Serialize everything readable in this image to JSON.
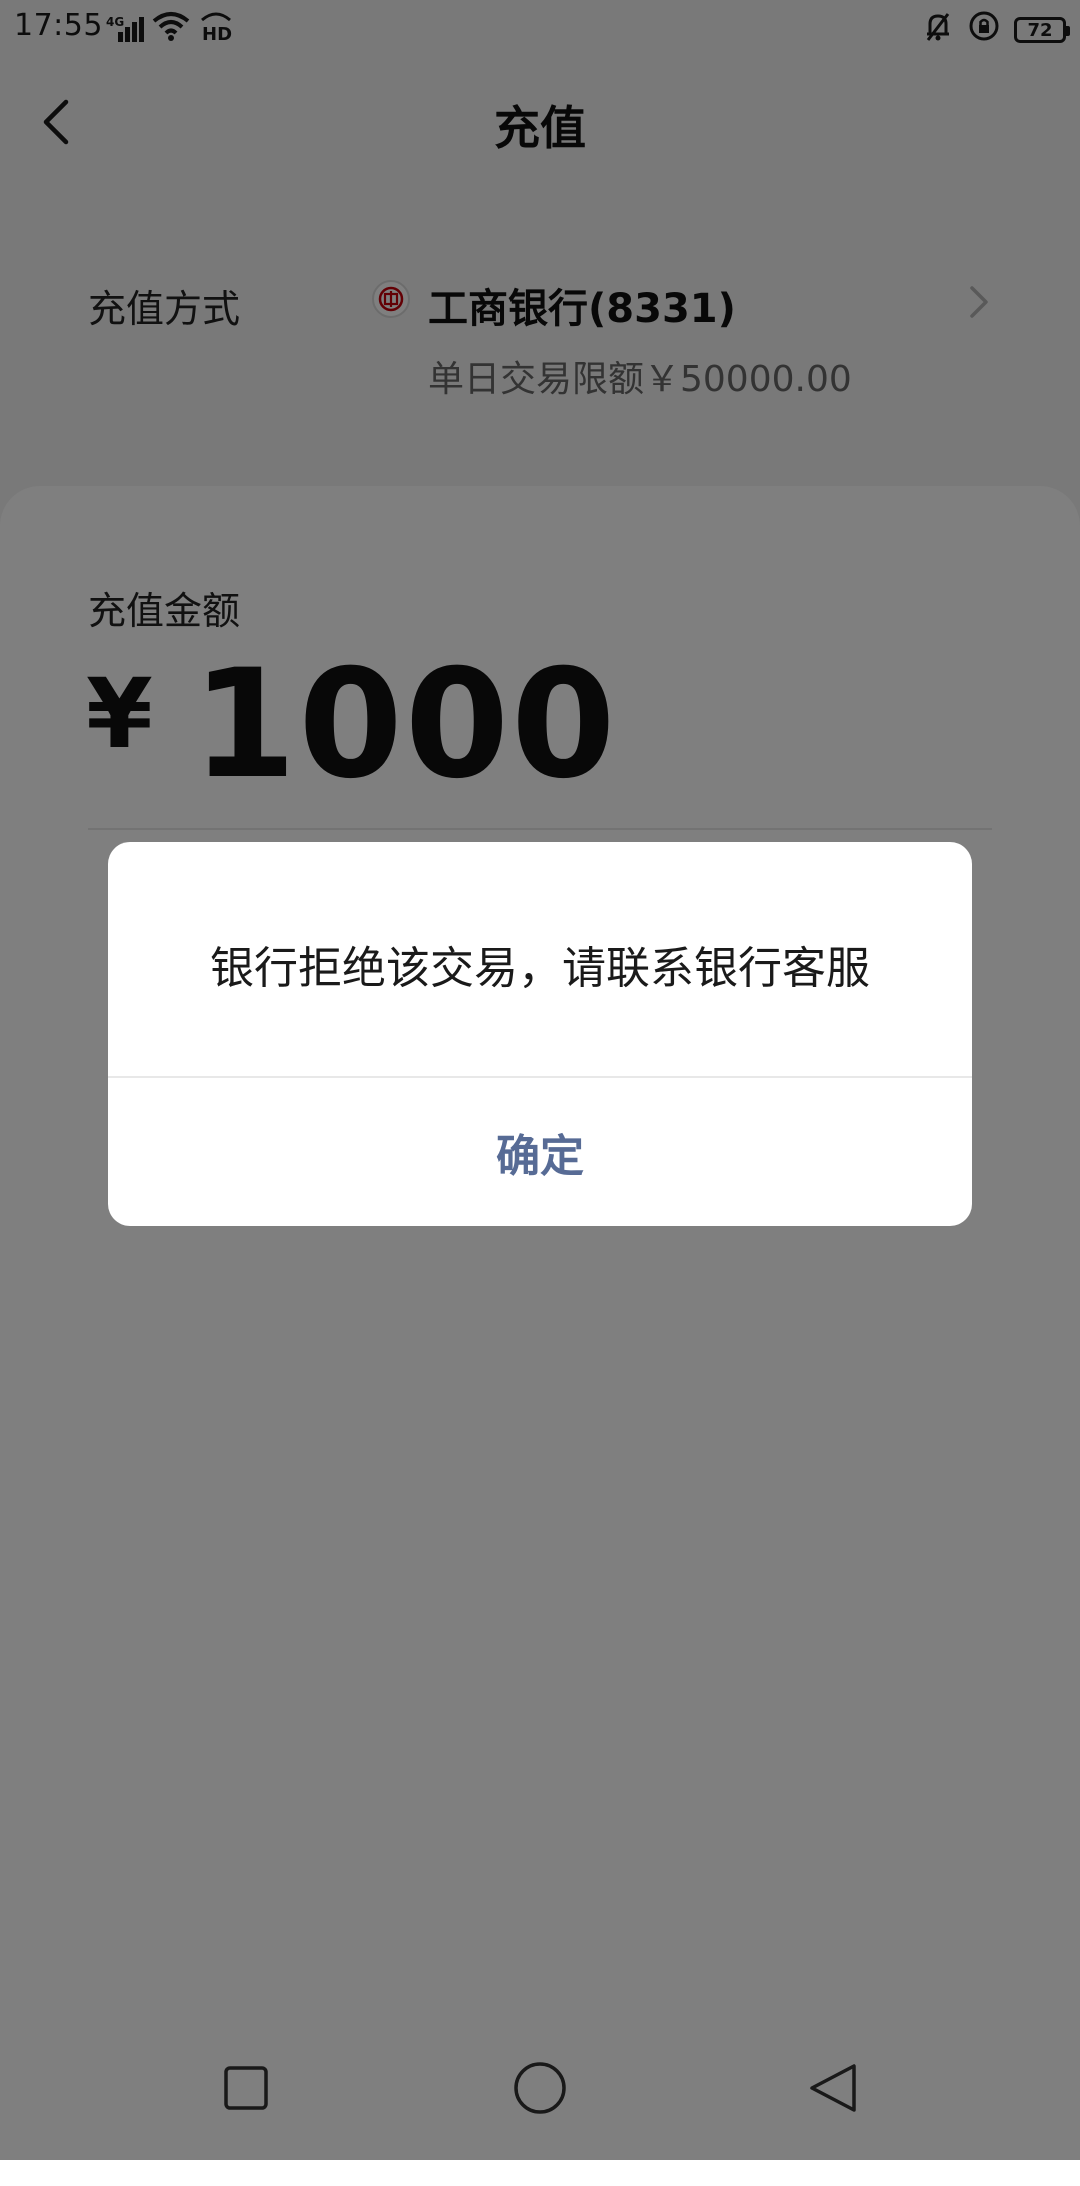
{
  "status_bar": {
    "time": "17:55",
    "signal_label": "4G",
    "battery": "72",
    "icons": [
      "signal-icon",
      "wifi-icon",
      "hd-icon",
      "mute-icon",
      "lock-rotation-icon",
      "battery-icon"
    ]
  },
  "header": {
    "title": "充值",
    "back_icon": "chevron-left-icon"
  },
  "payment_method": {
    "label": "充值方式",
    "bank_name": "工商银行(8331)",
    "limit_text": "单日交易限额￥50000.00",
    "bank_icon": "icbc-logo-icon",
    "chevron_icon": "chevron-right-icon"
  },
  "amount": {
    "label": "充值金额",
    "currency": "¥",
    "value": "1000"
  },
  "dialog": {
    "message": "银行拒绝该交易，请联系银行客服",
    "confirm_label": "确定"
  },
  "nav_bar": {
    "icons": [
      "recents-square-icon",
      "home-circle-icon",
      "back-triangle-icon"
    ]
  },
  "colors": {
    "dialog_button": "#576b95",
    "overlay": "rgba(0,0,0,0.5)",
    "bank_logo": "#c7000b"
  }
}
